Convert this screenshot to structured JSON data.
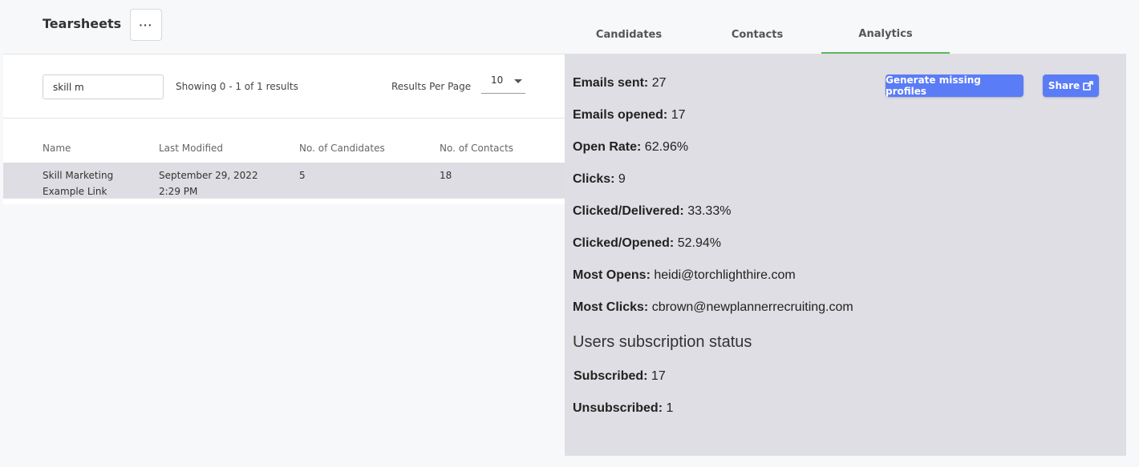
{
  "header": {
    "title": "Tearsheets",
    "more_label": "···"
  },
  "tabs": [
    {
      "label": "Candidates",
      "active": false
    },
    {
      "label": "Contacts",
      "active": false
    },
    {
      "label": "Analytics",
      "active": true
    }
  ],
  "toolbar": {
    "search_value": "skill m",
    "showing_text": "Showing 0 - 1 of 1 results",
    "results_per_page_label": "Results Per Page",
    "results_per_page_value": "10"
  },
  "table": {
    "columns": [
      "Name",
      "Last Modified",
      "No. of Candidates",
      "No. of Contacts"
    ],
    "rows": [
      {
        "name_line1": "Skill Marketing",
        "name_line2": "Example Link",
        "modified_line1": "September 29, 2022",
        "modified_line2": "2:29 PM",
        "candidates": "5",
        "contacts": "18"
      }
    ]
  },
  "analytics": {
    "generate_button_label": "Generate missing profiles",
    "share_button_label": "Share",
    "stats": [
      {
        "label": "Emails sent:",
        "value": "27"
      },
      {
        "label": "Emails opened:",
        "value": "17"
      },
      {
        "label": "Open Rate:",
        "value": "62.96%"
      },
      {
        "label": "Clicks:",
        "value": "9"
      },
      {
        "label": "Clicked/Delivered:",
        "value": "33.33%"
      },
      {
        "label": "Clicked/Opened:",
        "value": "52.94%"
      },
      {
        "label": "Most Opens:",
        "value": "heidi@torchlighthire.com"
      },
      {
        "label": "Most Clicks:",
        "value": "cbrown@newplannerrecruiting.com"
      }
    ],
    "subscription_title": "Users subscription status",
    "subscription": [
      {
        "label": "Subscribed:",
        "value": "17"
      },
      {
        "label": "Unsubscribed:",
        "value": "1"
      }
    ]
  },
  "colors": {
    "accent": "#5b7cf7",
    "active_tab_underline": "#5cb85c",
    "panel_bg": "#dedee4"
  }
}
